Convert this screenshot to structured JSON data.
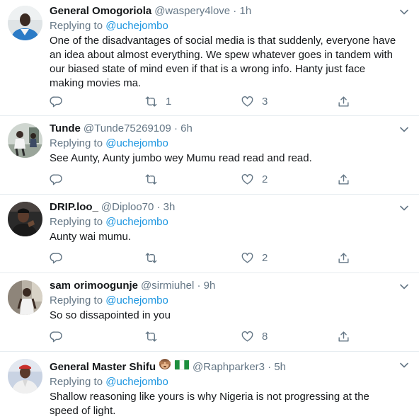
{
  "tweets": [
    {
      "name": "General Omogoriola",
      "handle": "@waspery4love · 1h",
      "reply_prefix": "Replying to ",
      "reply_to": "@uchejombo",
      "text": "One of the disadvantages of social media is that suddenly, everyone have an idea about almost everything. We spew whatever goes in tandem with our biased state of mind even if that is a wrong info. Hanty just face making movies ma.",
      "retweets": "1",
      "likes": "3"
    },
    {
      "name": "Tunde",
      "handle": "@Tunde75269109 · 6h",
      "reply_prefix": "Replying to ",
      "reply_to": "@uchejombo",
      "text": "See Aunty, Aunty jumbo wey Mumu read read and read.",
      "retweets": "",
      "likes": "2"
    },
    {
      "name": "DRIP.loo_",
      "handle": "@Diploo70 · 3h",
      "reply_prefix": "Replying to ",
      "reply_to": "@uchejombo",
      "text": "Aunty wai mumu.",
      "retweets": "",
      "likes": "2"
    },
    {
      "name": "sam orimoogunje",
      "handle": "@sirmiuhel · 9h",
      "reply_prefix": "Replying to ",
      "reply_to": "@uchejombo",
      "text": "So so dissapointed in you",
      "retweets": "",
      "likes": "8"
    },
    {
      "name": "General Master Shifu",
      "handle": "@Raphparker3 · 5h",
      "reply_prefix": "Replying to ",
      "reply_to": "@uchejombo",
      "text": "Shallow reasoning like yours is why Nigeria is not progressing at the speed of light."
    }
  ],
  "colors": {
    "accent": "#1b95e0",
    "secondary_text": "#657786",
    "divider": "#e6ecf0"
  },
  "icons": [
    "reply-icon",
    "retweet-icon",
    "like-icon",
    "share-icon",
    "chevron-down-icon",
    "see-no-evil-monkey-emoji",
    "nigeria-flag-emoji"
  ]
}
